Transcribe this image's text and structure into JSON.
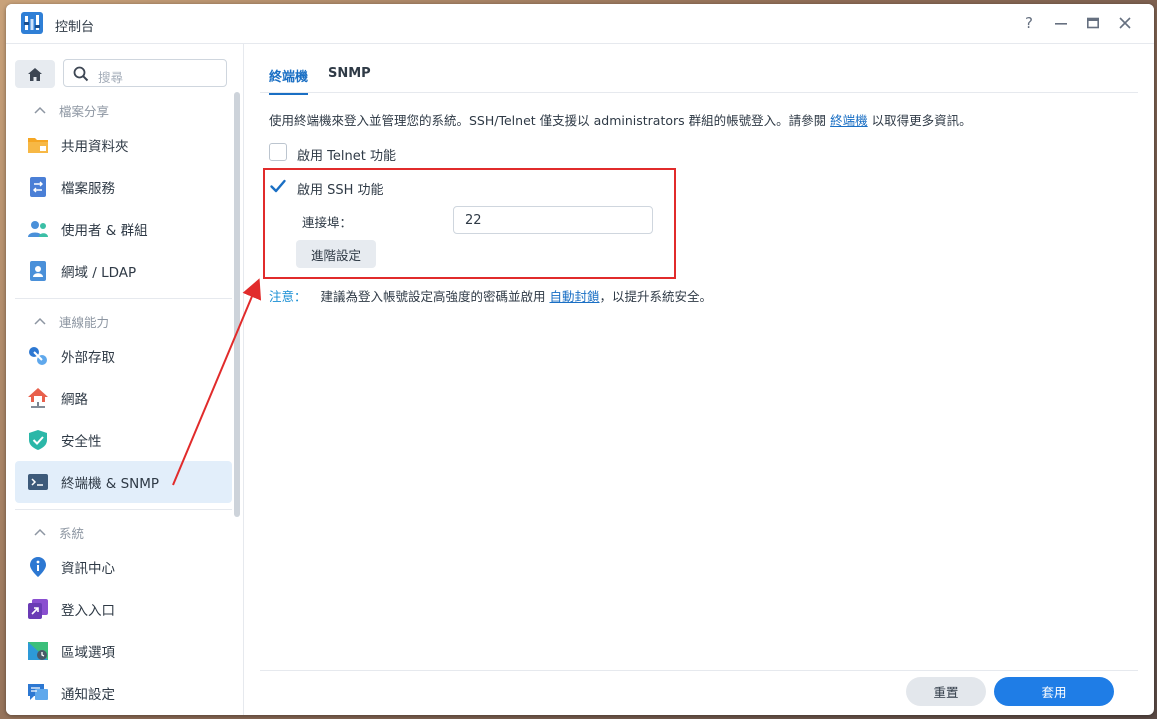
{
  "window": {
    "title": "控制台",
    "controls": {
      "help": "?",
      "minimize": "—",
      "maximize": "▢",
      "close": "✕"
    }
  },
  "sidebar": {
    "search_placeholder": "搜尋",
    "groups": [
      {
        "label": "檔案分享",
        "items": [
          {
            "label": "共用資料夾",
            "icon": "folder-icon"
          },
          {
            "label": "檔案服務",
            "icon": "file-services-icon"
          },
          {
            "label": "使用者 & 群組",
            "icon": "users-icon"
          },
          {
            "label": "網域 / LDAP",
            "icon": "domain-icon"
          }
        ]
      },
      {
        "label": "連線能力",
        "items": [
          {
            "label": "外部存取",
            "icon": "external-access-icon"
          },
          {
            "label": "網路",
            "icon": "network-icon"
          },
          {
            "label": "安全性",
            "icon": "shield-icon"
          },
          {
            "label": "終端機 & SNMP",
            "icon": "terminal-icon",
            "active": true
          }
        ]
      },
      {
        "label": "系統",
        "items": [
          {
            "label": "資訊中心",
            "icon": "info-icon"
          },
          {
            "label": "登入入口",
            "icon": "login-portal-icon"
          },
          {
            "label": "區域選項",
            "icon": "regional-options-icon"
          },
          {
            "label": "通知設定",
            "icon": "notification-icon"
          }
        ]
      }
    ]
  },
  "main": {
    "tabs": [
      {
        "label": "終端機",
        "active": true
      },
      {
        "label": "SNMP",
        "active": false
      }
    ],
    "description": {
      "before": "使用終端機來登入並管理您的系統。SSH/Telnet 僅支援以 administrators 群組的帳號登入。請參閱 ",
      "link": "終端機",
      "after": " 以取得更多資訊。"
    },
    "telnet": {
      "label": "啟用 Telnet 功能",
      "checked": false
    },
    "ssh": {
      "label": "啟用 SSH 功能",
      "checked": true
    },
    "port": {
      "label": "連接埠：",
      "value": "22"
    },
    "advanced_button": "進階設定",
    "note": {
      "label": "注意：",
      "before": "建議為登入帳號設定高強度的密碼並啟用 ",
      "link": "自動封鎖",
      "after": "，以提升系統安全。"
    },
    "buttons": {
      "reset": "重置",
      "apply": "套用"
    }
  },
  "colors": {
    "accent": "#1f7de6",
    "link": "#1a6fc4",
    "annotation": "#e12b2b",
    "active_item_bg": "#e2eefa"
  }
}
